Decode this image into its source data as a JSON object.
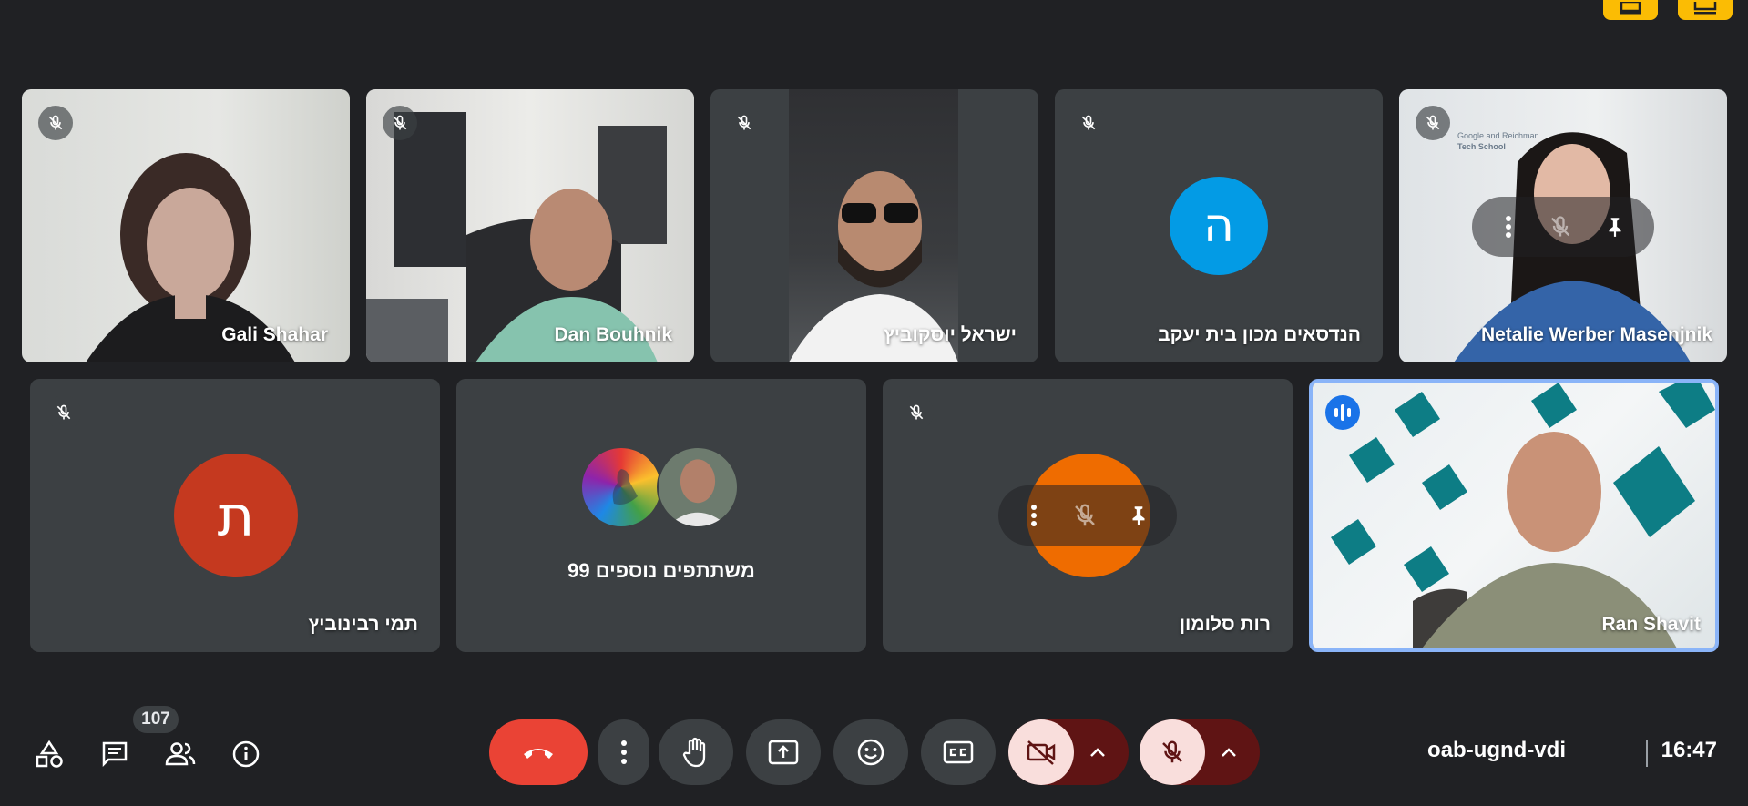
{
  "participants": {
    "gali": {
      "name": "Gali Shahar",
      "muted": true
    },
    "dan": {
      "name": "Dan Bouhnik",
      "muted": true
    },
    "israel": {
      "name": "ישראל יוסקוביץ",
      "muted": true
    },
    "handasaim": {
      "name": "הנדסאים מכון בית יעקב",
      "initial": "ה",
      "avatar_color": "#039be5",
      "muted": true
    },
    "netalie": {
      "name": "Netalie Werber Masenjnik",
      "muted": true,
      "bg_text_1": "Google and Reichman",
      "bg_text_2": "Tech School"
    },
    "tami": {
      "name": "תמי רבינוביץ",
      "initial": "ת",
      "avatar_color": "#c5391f",
      "muted": true
    },
    "others": {
      "label": "99 משתתפים נוספים"
    },
    "ruth": {
      "name": "רות סלומון",
      "avatar_color": "#ef6c00",
      "muted": true
    },
    "ran": {
      "name": "Ran Shavit",
      "speaking": true
    }
  },
  "toolbar": {
    "participants_count": "107",
    "meeting_code": "oab-ugnd-vdi",
    "time": "16:47"
  },
  "colors": {
    "background": "#202124",
    "tile": "#3c4043",
    "end_call": "#ea4335",
    "muted_dark": "#5f1414",
    "muted_light": "#f9dedc",
    "highlight": "#fbbc04",
    "speaking": "#1a73e8"
  }
}
